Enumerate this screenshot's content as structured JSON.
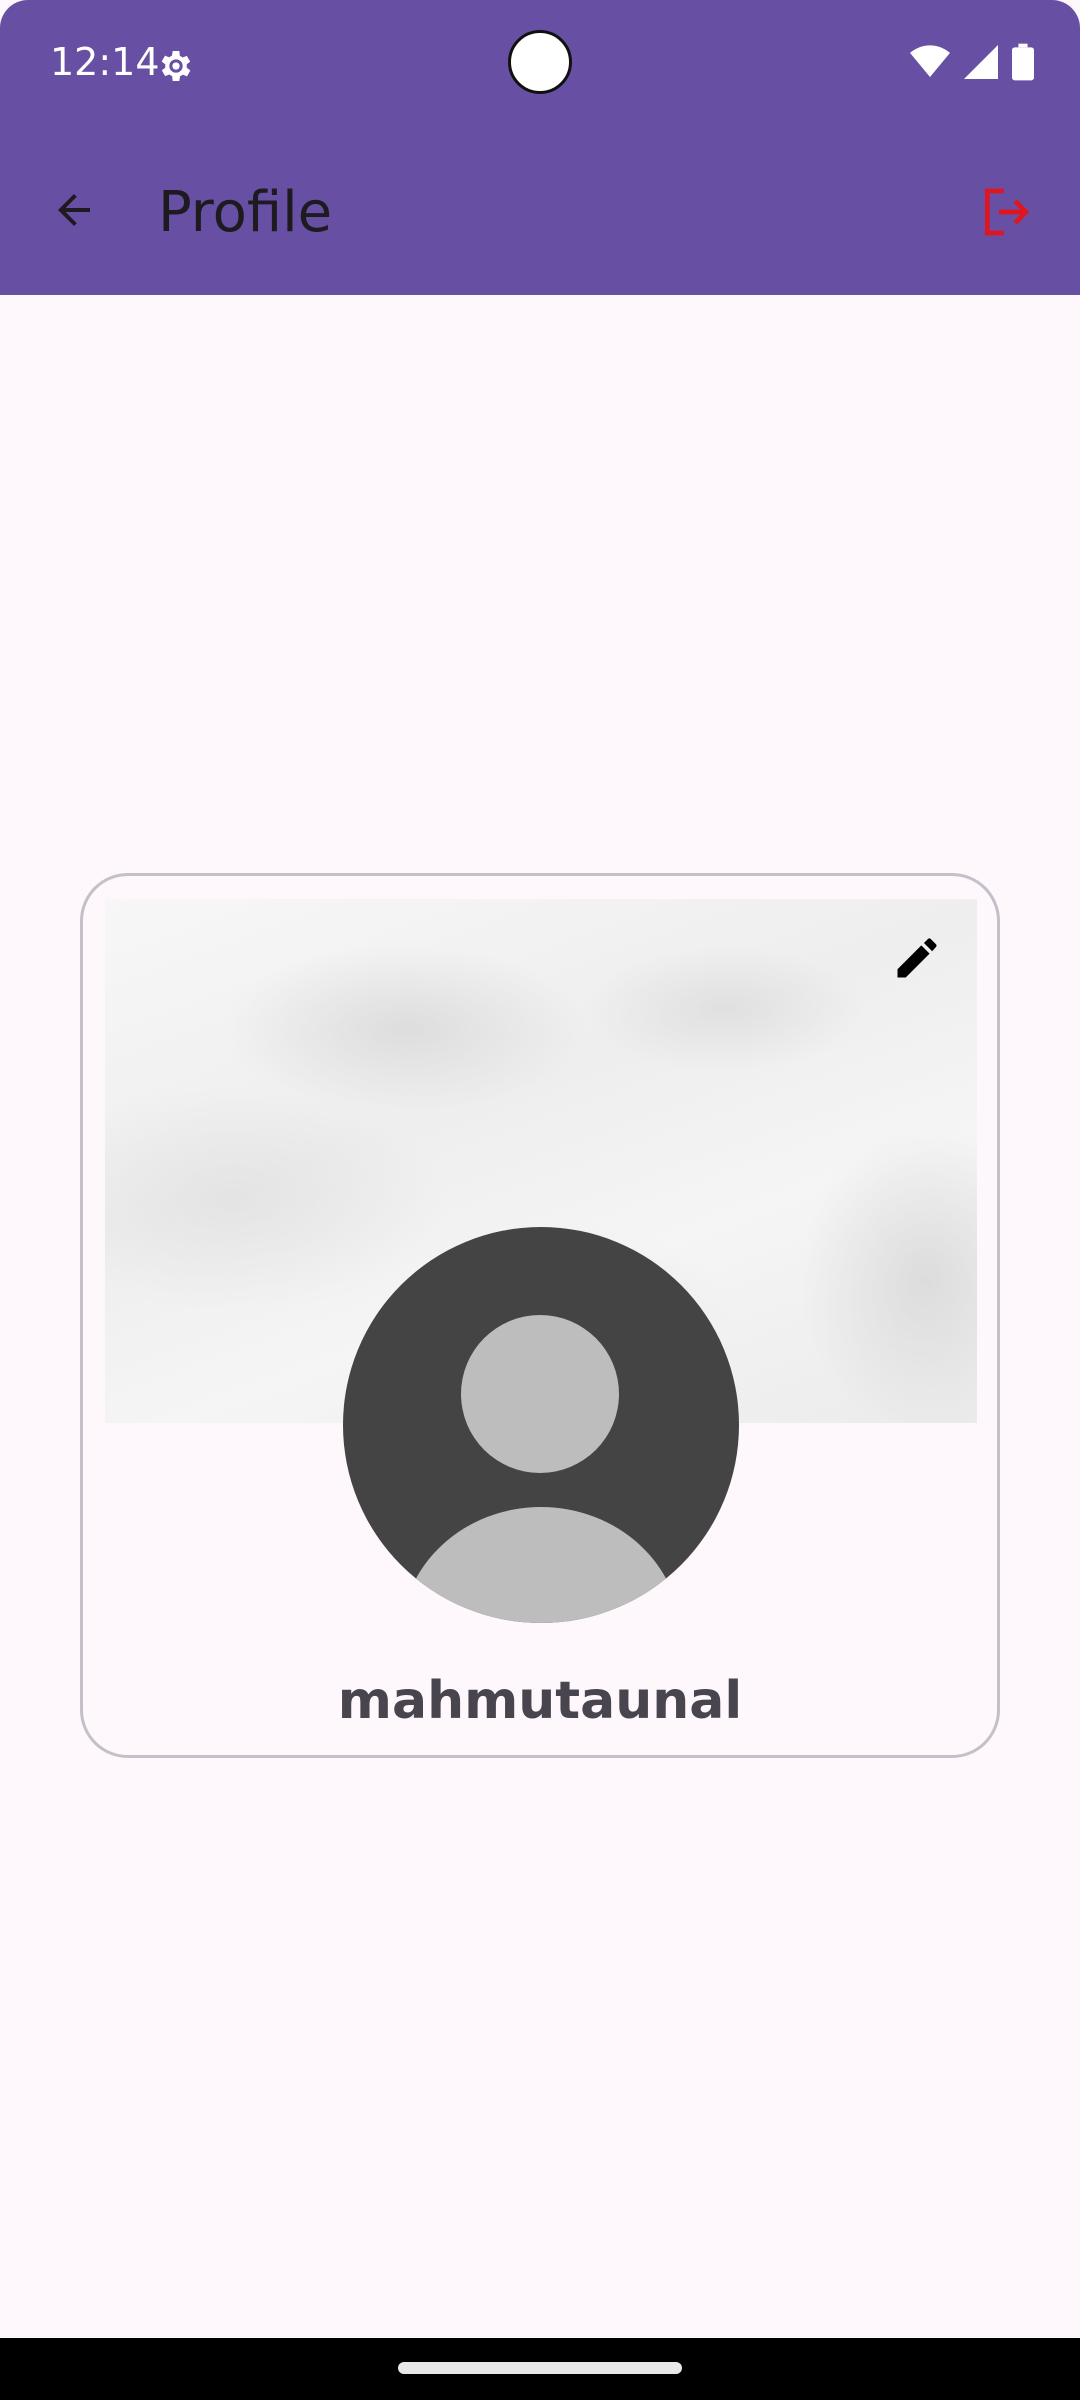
{
  "status_bar": {
    "time": "12:14",
    "icons": [
      "settings-gear-icon",
      "wifi-icon",
      "cellular-signal-icon",
      "battery-icon"
    ],
    "color": "#6750a4"
  },
  "app_bar": {
    "title": "Profile",
    "back_icon": "arrow-back-icon",
    "logout_icon": "logout-icon",
    "logout_color": "#e0151f"
  },
  "profile": {
    "username": "mahmutaunal",
    "edit_icon": "pencil-icon",
    "avatar_icon": "default-avatar-icon"
  }
}
